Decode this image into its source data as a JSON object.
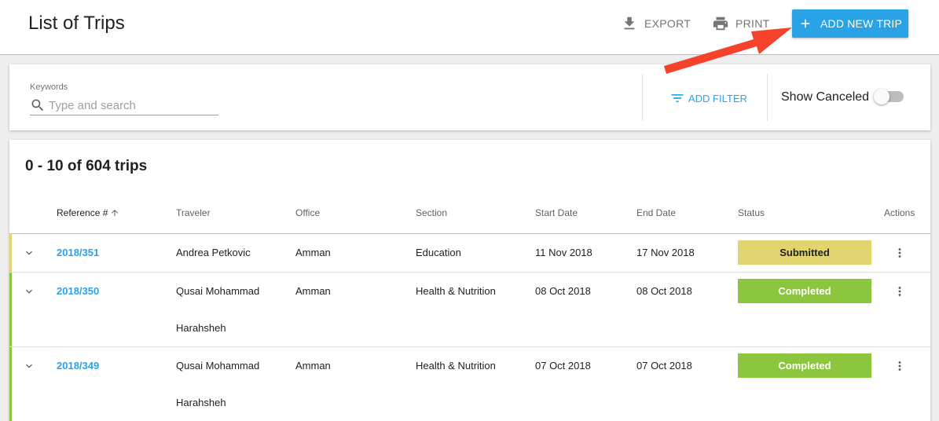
{
  "header": {
    "title": "List of Trips",
    "export_label": "EXPORT",
    "print_label": "PRINT",
    "add_label": "ADD NEW TRIP"
  },
  "filters": {
    "keywords_label": "Keywords",
    "search_placeholder": "Type and search",
    "search_value": "",
    "add_filter_label": "ADD FILTER",
    "show_canceled_label": "Show Canceled",
    "show_canceled_on": false
  },
  "list": {
    "count_text": "0 - 10 of 604 trips",
    "columns": [
      "Reference #",
      "Traveler",
      "Office",
      "Section",
      "Start Date",
      "End Date",
      "Status",
      "Actions"
    ],
    "rows": [
      {
        "reference": "2018/351",
        "traveler": "Andrea Petkovic",
        "office": "Amman",
        "section": "Education",
        "start_date": "11 Nov 2018",
        "end_date": "17 Nov 2018",
        "status": "Submitted"
      },
      {
        "reference": "2018/350",
        "traveler": "Qusai Mohammad Harahsheh",
        "office": "Amman",
        "section": "Health & Nutrition",
        "start_date": "08 Oct 2018",
        "end_date": "08 Oct 2018",
        "status": "Completed"
      },
      {
        "reference": "2018/349",
        "traveler": "Qusai Mohammad Harahsheh",
        "office": "Amman",
        "section": "Health & Nutrition",
        "start_date": "07 Oct 2018",
        "end_date": "07 Oct 2018",
        "status": "Completed"
      }
    ]
  },
  "colors": {
    "accent": "#2aa3e6",
    "submitted_bg": "#e2d46e",
    "submitted_fg": "#212121",
    "completed_bg": "#8cc63e",
    "completed_fg": "#ffffff",
    "annotation_arrow": "#f4422b"
  },
  "icons": {
    "export": "download-icon",
    "print": "printer-icon",
    "add": "plus-icon",
    "search": "search-icon",
    "filter": "filter-icon",
    "sort": "arrow-up-icon",
    "expand": "chevron-down-icon",
    "actions": "more-vertical-icon"
  }
}
